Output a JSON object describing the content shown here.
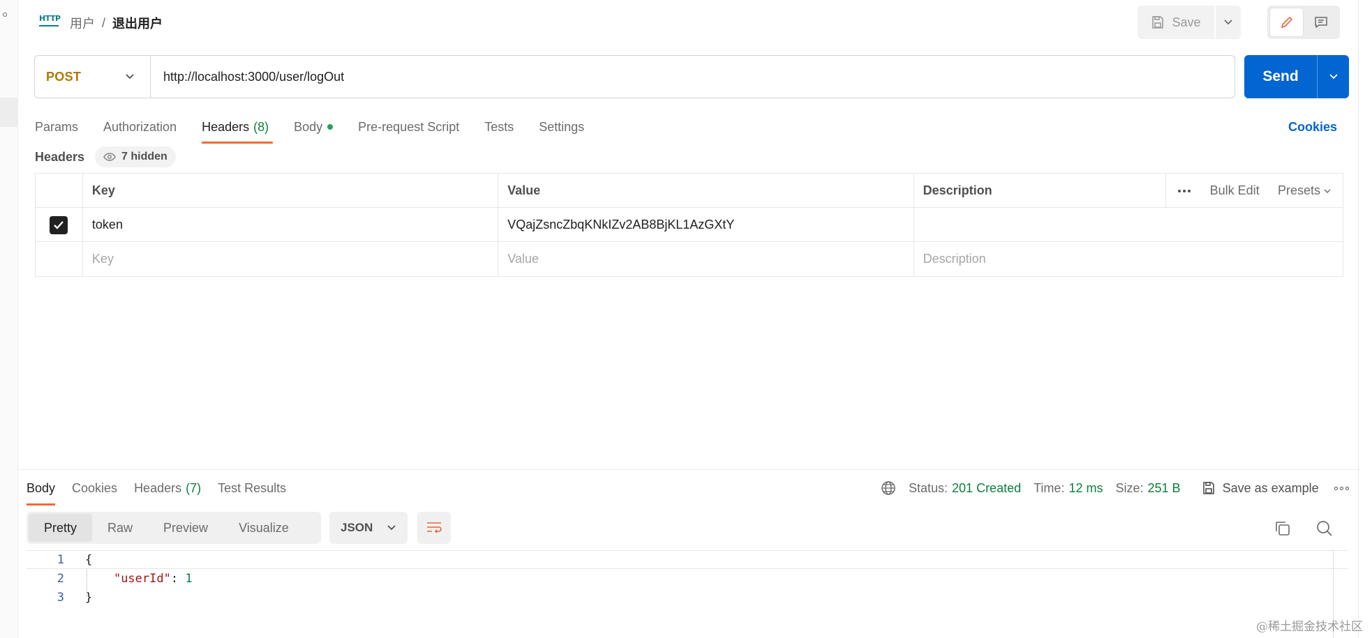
{
  "breadcrumb": {
    "icon_text": "HTTP",
    "parent": "用户",
    "separator": "/",
    "current": "退出用户"
  },
  "toolbar": {
    "save_label": "Save"
  },
  "request": {
    "method": "POST",
    "url": "http://localhost:3000/user/logOut",
    "send_label": "Send"
  },
  "request_tabs": {
    "params": "Params",
    "authorization": "Authorization",
    "headers": "Headers",
    "headers_count": "(8)",
    "body": "Body",
    "pre_request": "Pre-request Script",
    "tests": "Tests",
    "settings": "Settings",
    "cookies": "Cookies"
  },
  "headers_section": {
    "label": "Headers",
    "hidden_text": "7 hidden",
    "columns": {
      "key": "Key",
      "value": "Value",
      "description": "Description"
    },
    "actions": {
      "bulk_edit": "Bulk Edit",
      "presets": "Presets"
    },
    "rows": [
      {
        "checked": true,
        "key": "token",
        "value": "VQajZsncZbqKNkIZv2AB8BjKL1AzGXtY",
        "description": ""
      }
    ],
    "placeholders": {
      "key": "Key",
      "value": "Value",
      "description": "Description"
    }
  },
  "response": {
    "tabs": {
      "body": "Body",
      "cookies": "Cookies",
      "headers": "Headers",
      "headers_count": "(7)",
      "test_results": "Test Results"
    },
    "status_label": "Status:",
    "status_value": "201 Created",
    "time_label": "Time:",
    "time_value": "12 ms",
    "size_label": "Size:",
    "size_value": "251 B",
    "save_example": "Save as example",
    "formats": {
      "pretty": "Pretty",
      "raw": "Raw",
      "preview": "Preview",
      "visualize": "Visualize"
    },
    "language": "JSON",
    "code": {
      "line_numbers": [
        "1",
        "2",
        "3"
      ],
      "open_brace": "{",
      "key": "\"userId\"",
      "colon": ": ",
      "value": "1",
      "close_brace": "}"
    }
  },
  "watermark": "@稀土掘金技术社区",
  "colors": {
    "accent": "#0265d2",
    "tab_underline": "#f06a35",
    "method": "#ad7a03",
    "status_ok": "#0a7f3c"
  }
}
